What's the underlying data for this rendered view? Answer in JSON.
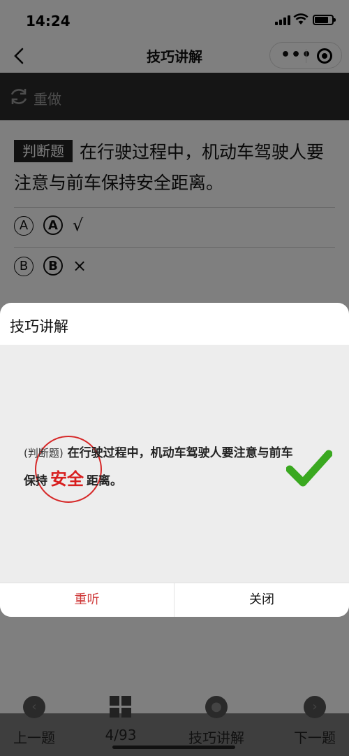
{
  "status": {
    "time": "14:24"
  },
  "nav": {
    "title": "技巧讲解"
  },
  "toolbar": {
    "redo_label": "重做"
  },
  "question": {
    "tag": "判断题",
    "text": "在行驶过程中，机动车驾驶人要注意与前车保持安全距离。",
    "options": [
      {
        "marker": "Ⓐ",
        "letter": "A",
        "text": "√"
      },
      {
        "marker": "Ⓑ",
        "letter": "B",
        "text": "×"
      }
    ]
  },
  "bottom_nav": {
    "prev": "上一题",
    "progress": "4/93",
    "tips": "技巧讲解",
    "next": "下一题"
  },
  "modal": {
    "title": "技巧讲解",
    "explanation": {
      "type": "(判断题)",
      "line1": "在行驶过程中，机动车驾驶人要注意与前车",
      "line2_prefix": "保持",
      "keyword": "安全",
      "line2_suffix": "距离。"
    },
    "buttons": {
      "relisten": "重听",
      "close": "关闭"
    }
  },
  "colors": {
    "accent_red": "#cf3a3a",
    "check_green": "#3aa820",
    "toolbar_bg": "#2b2b2b"
  },
  "icons": [
    "back-icon",
    "more-icon",
    "target-icon",
    "redo-icon",
    "prev-icon",
    "grid-icon",
    "mic-icon",
    "next-icon",
    "check-icon"
  ]
}
